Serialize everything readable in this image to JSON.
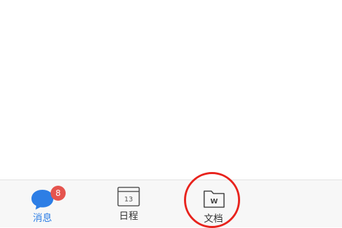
{
  "tabbar": {
    "tabs": [
      {
        "label": "消息",
        "icon": "chat-bubble-icon",
        "badge_count": "8",
        "active": true
      },
      {
        "label": "日程",
        "icon": "calendar-icon",
        "date_number": "13"
      },
      {
        "label": "文档",
        "icon": "document-folder-icon",
        "glyph": "W"
      }
    ]
  },
  "colors": {
    "active_tab": "#2d7ee5",
    "badge": "#e5544e",
    "highlight_ring": "#e8231d",
    "tabbar_bg": "#f7f7f7"
  }
}
